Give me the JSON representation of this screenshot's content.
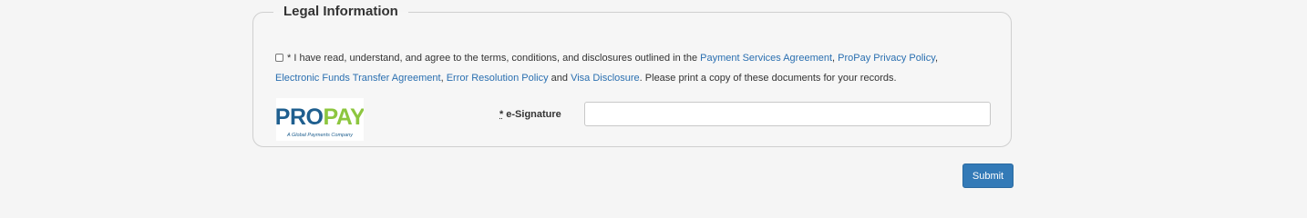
{
  "legal": {
    "legend": "Legal Information",
    "terms": {
      "intro": "* I have read, understand, and agree to the terms, conditions, and disclosures outlined in the ",
      "link_psa": "Payment Services Agreement",
      "sep1": ", ",
      "link_privacy": "ProPay Privacy Policy",
      "sep2": ",",
      "link_eft": "Electronic Funds Transfer Agreement",
      "sep3": ", ",
      "link_error": "Error Resolution Policy",
      "sep4": " and ",
      "link_visa": "Visa Disclosure",
      "outro": ". Please print a copy of these documents for your records."
    },
    "logo": {
      "brand": "PROPAY",
      "tagline": "A Global Payments Company",
      "colors": {
        "pro": "#1f5f8f",
        "pay": "#8dc63f"
      }
    },
    "signature": {
      "required_mark": "*",
      "label": "e-Signature",
      "value": "",
      "placeholder": ""
    }
  },
  "actions": {
    "submit_label": "Submit"
  },
  "colors": {
    "link": "#2a6fb0",
    "button": "#337ab7"
  }
}
